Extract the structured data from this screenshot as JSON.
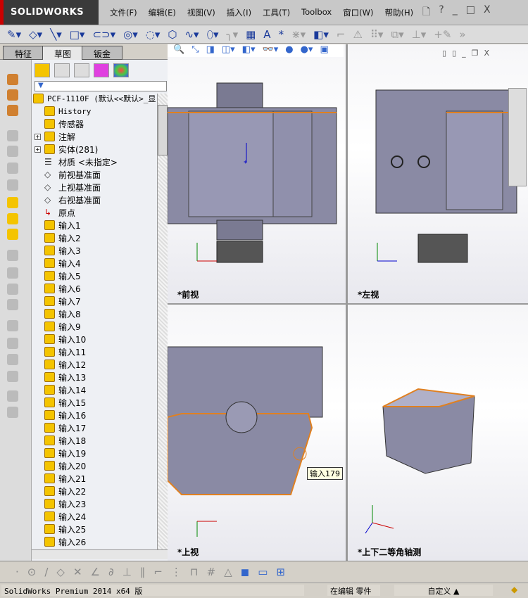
{
  "app": {
    "logo": "SOLIDWORKS"
  },
  "menu": [
    "文件(F)",
    "编辑(E)",
    "视图(V)",
    "插入(I)",
    "工具(T)",
    "Toolbox",
    "窗口(W)",
    "帮助(H)"
  ],
  "window_buttons": [
    "?",
    "_",
    "□",
    "X"
  ],
  "tabs": [
    "特征",
    "草图",
    "钣金"
  ],
  "active_tab": "草图",
  "tree": {
    "filter_icon": "funnel-icon",
    "root": "PCF-1110F  (默认<<默认>_显",
    "items": [
      "History",
      "传感器",
      "注解",
      "实体(281)",
      "材质 <未指定>",
      "前视基准面",
      "上视基准面",
      "右视基准面",
      "原点",
      "输入1",
      "输入2",
      "输入3",
      "输入4",
      "输入5",
      "输入6",
      "输入7",
      "输入8",
      "输入9",
      "输入10",
      "输入11",
      "输入12",
      "输入13",
      "输入14",
      "输入15",
      "输入16",
      "输入17",
      "输入18",
      "输入19",
      "输入20",
      "输入21",
      "输入22",
      "输入23",
      "输入24",
      "输入25",
      "输入26"
    ]
  },
  "viewports": {
    "front": "*前视",
    "left": "*左视",
    "top": "*上视",
    "iso": "*上下二等角轴测"
  },
  "tooltip": "输入179",
  "status": {
    "version": "SolidWorks Premium 2014 x64 版",
    "mode": "在编辑 零件",
    "units": "自定义"
  },
  "colors": {
    "accent": "#cc0000",
    "edge": "#e08020",
    "body": "#8888a0"
  }
}
